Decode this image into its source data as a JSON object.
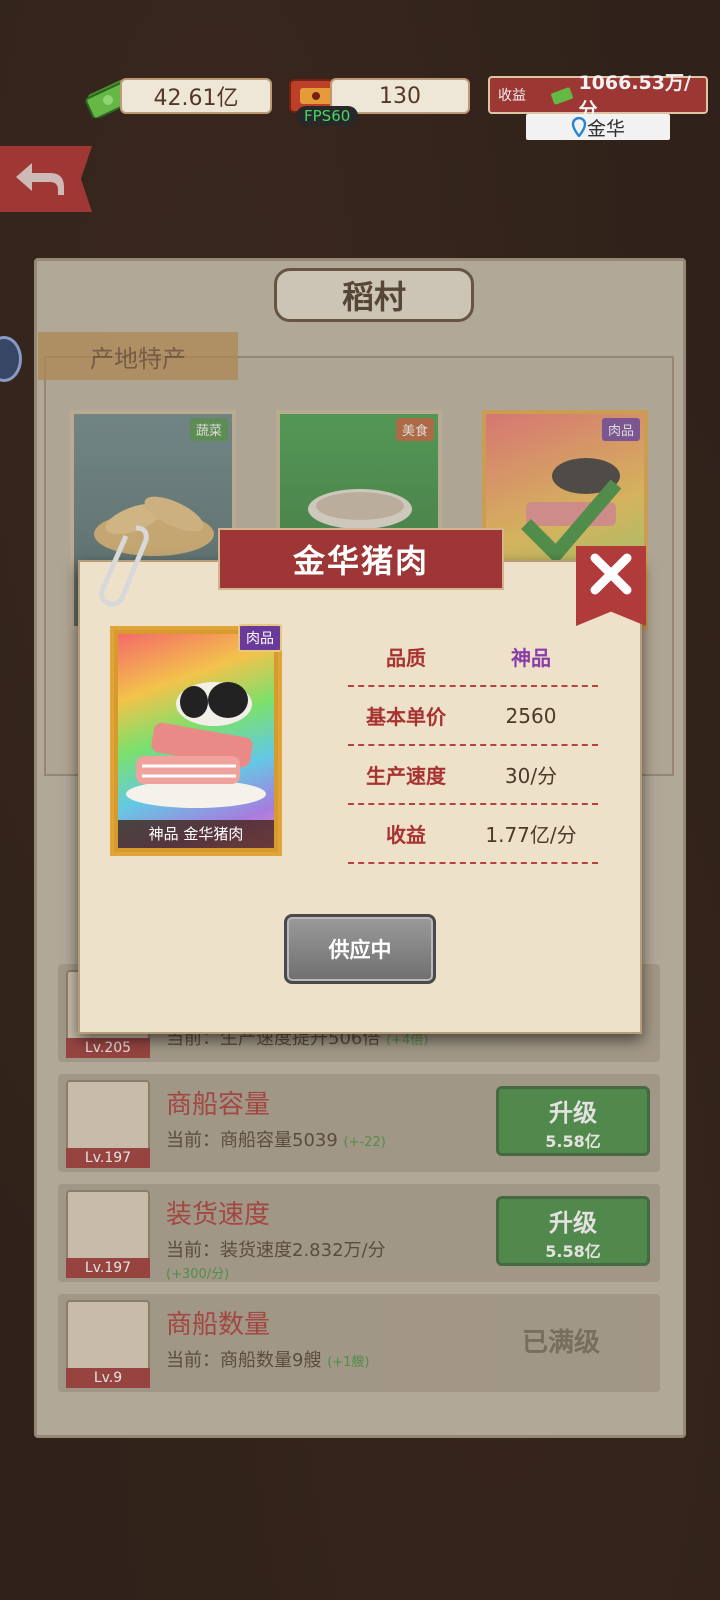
{
  "hud": {
    "cash": "42.61亿",
    "tickets": "130",
    "fps": "FPS60",
    "income_label": "收益",
    "income_value": "1066.53万/分",
    "city": "金华"
  },
  "panel": {
    "title": "稻村",
    "section_tab": "产地特产",
    "cards": [
      {
        "tag": "蔬菜",
        "tag_color": "#3f8a3f"
      },
      {
        "tag": "美食",
        "tag_color": "#b5562a"
      },
      {
        "tag": "肉品",
        "tag_color": "#6a3a9a"
      }
    ],
    "rows": [
      {
        "level": "Lv.205",
        "name": "",
        "current": "当前：生产速度提升506倍",
        "plus": "(+4倍)"
      },
      {
        "level": "Lv.197",
        "name": "商船容量",
        "current": "当前：商船容量5039",
        "plus": "(+-22)",
        "button": "升级",
        "price": "5.58亿"
      },
      {
        "level": "Lv.197",
        "name": "装货速度",
        "current": "当前：装货速度2.832万/分",
        "plus": "(+300/分)",
        "button": "升级",
        "price": "5.58亿"
      },
      {
        "level": "Lv.9",
        "name": "商船数量",
        "current": "当前：商船数量9艘",
        "plus": "(+1艘)",
        "maxed": "已满级"
      }
    ]
  },
  "popup": {
    "title": "金华猪肉",
    "card_tag": "肉品",
    "card_caption": "神品  金华猪肉",
    "stats": [
      {
        "key": "品质",
        "value": "神品"
      },
      {
        "key": "基本单价",
        "value": "2560"
      },
      {
        "key": "生产速度",
        "value": "30/分"
      },
      {
        "key": "收益",
        "value": "1.77亿/分"
      }
    ],
    "supply_button": "供应中"
  },
  "colors": {
    "accent_red": "#9e3636",
    "legend_purple": "#8a3ca8",
    "upgrade_green": "#3e8a3e"
  }
}
